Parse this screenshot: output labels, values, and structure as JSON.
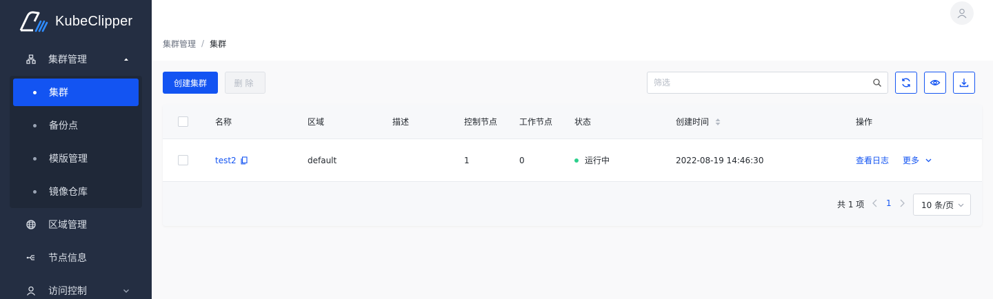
{
  "app": {
    "brand": "KubeClipper"
  },
  "sidebar": {
    "groups": [
      {
        "label": "集群管理",
        "icon": "cluster-icon",
        "expanded": true
      },
      {
        "label": "区域管理",
        "icon": "globe-icon"
      },
      {
        "label": "节点信息",
        "icon": "node-icon"
      },
      {
        "label": "访问控制",
        "icon": "user-icon",
        "expanded": false
      }
    ],
    "sub_items": [
      {
        "label": "集群",
        "active": true
      },
      {
        "label": "备份点"
      },
      {
        "label": "模版管理"
      },
      {
        "label": "镜像仓库"
      }
    ]
  },
  "breadcrumb": {
    "parent": "集群管理",
    "separator": "/",
    "current": "集群"
  },
  "toolbar": {
    "create_label": "创建集群",
    "delete_label": "删除",
    "search_placeholder": "筛选",
    "accent": "#1354f2"
  },
  "table": {
    "columns": {
      "name": "名称",
      "region": "区域",
      "description": "描述",
      "control_nodes": "控制节点",
      "worker_nodes": "工作节点",
      "status": "状态",
      "created_at": "创建时间",
      "actions": "操作"
    },
    "rows": [
      {
        "name": "test2",
        "region": "default",
        "description": "",
        "control_nodes": "1",
        "worker_nodes": "0",
        "status": "运行中",
        "status_color": "#2ccf8c",
        "created_at": "2022-08-19 14:46:30",
        "action_logs": "查看日志",
        "action_more": "更多"
      }
    ]
  },
  "pagination": {
    "total_label": "共 1 项",
    "current_page": "1",
    "page_size_label": "10 条/页"
  }
}
